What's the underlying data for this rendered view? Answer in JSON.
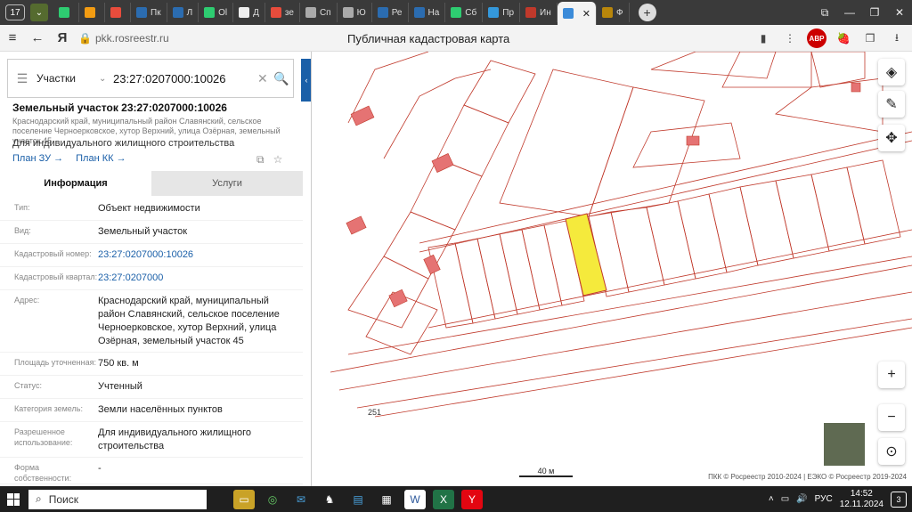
{
  "browser": {
    "tab_count": "17",
    "tabs": [
      {
        "label": "",
        "color": "#2ecc71"
      },
      {
        "label": "",
        "color": "#f39c12"
      },
      {
        "label": "",
        "color": "#e74c3c"
      },
      {
        "label": "Пк",
        "color": "#2b6cb0"
      },
      {
        "label": "Л",
        "color": "#2b6cb0"
      },
      {
        "label": "Ol",
        "color": "#2ecc71"
      },
      {
        "label": "Д",
        "color": "#eeeeee"
      },
      {
        "label": "зе",
        "color": "#e74c3c"
      },
      {
        "label": "Сп",
        "color": "#aaaaaa"
      },
      {
        "label": "Ю",
        "color": "#aaaaaa"
      },
      {
        "label": "Ре",
        "color": "#2b6cb0"
      },
      {
        "label": "На",
        "color": "#2b6cb0"
      },
      {
        "label": "Сб",
        "color": "#2ecc71"
      },
      {
        "label": "Пр",
        "color": "#3498db"
      },
      {
        "label": "Ин",
        "color": "#c0392b"
      }
    ],
    "active_tab": "",
    "last_tab": "Ф",
    "url": "pkk.rosreestr.ru",
    "page_title": "Публичная кадастровая карта"
  },
  "search": {
    "type": "Участки",
    "value": "23:27:0207000:10026"
  },
  "object": {
    "title": "Земельный участок 23:27:0207000:10026",
    "address_short": "Краснодарский край, муниципальный район Славянский, сельское поселение Черноерковское, хутор Верхний, улица Озёрная, земельный участок 45",
    "purpose": "Для индивидуального жилищного строительства",
    "plan_zu": "План ЗУ →",
    "plan_kk": "План КК →"
  },
  "tabs": {
    "info": "Информация",
    "services": "Услуги"
  },
  "fields": [
    {
      "key": "Тип:",
      "value": "Объект недвижимости",
      "link": false
    },
    {
      "key": "Вид:",
      "value": "Земельный участок",
      "link": false
    },
    {
      "key": "Кадастровый номер:",
      "value": "23:27:0207000:10026",
      "link": true
    },
    {
      "key": "Кадастровый квартал:",
      "value": "23:27:0207000",
      "link": true
    },
    {
      "key": "Адрес:",
      "value": "Краснодарский край, муниципальный район Славянский, сельское поселение Черноерковское, хутор Верхний, улица Озёрная, земельный участок 45",
      "link": false
    },
    {
      "key": "Площадь уточненная:",
      "value": "750 кв. м",
      "link": false
    },
    {
      "key": "Статус:",
      "value": "Учтенный",
      "link": false
    },
    {
      "key": "Категория земель:",
      "value": "Земли населённых пунктов",
      "link": false
    },
    {
      "key": "Разрешенное использование:",
      "value": "Для индивидуального жилищного строительства",
      "link": false
    },
    {
      "key": "Форма собственности:",
      "value": "-",
      "link": false
    }
  ],
  "map": {
    "scale": "40 м",
    "copyright": "ПКК © Росреестр 2010-2024 | ЕЭКО © Росреестр 2019-2024",
    "road_label": "251",
    "highlight_color": "#f5ea3c",
    "parcel_color": "#c0392b"
  },
  "taskbar": {
    "search": "Поиск",
    "lang": "РУС",
    "time": "14:52",
    "date": "12.11.2024",
    "notifications": "3"
  }
}
